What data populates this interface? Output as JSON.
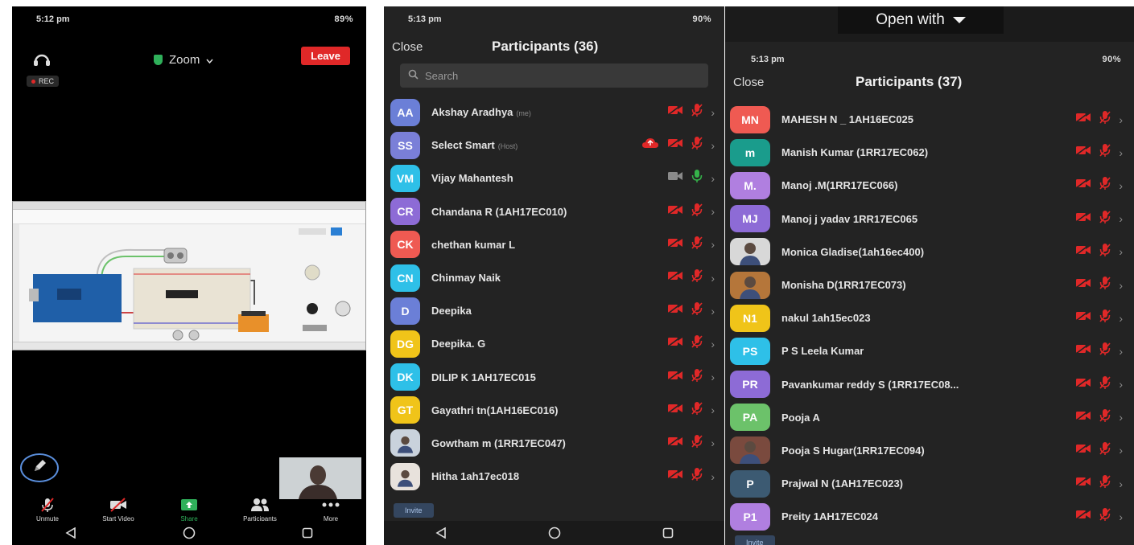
{
  "colors": {
    "accent_red": "#e02828",
    "mic_green": "#35b34a",
    "panel_bg": "#232323",
    "share_green": "#2fb05a"
  },
  "phone1": {
    "status": {
      "time": "5:12 pm",
      "icons": "89%"
    },
    "meeting_title": "Zoom",
    "leave_label": "Leave",
    "rec_label": "REC",
    "controls": [
      {
        "label": "Unmute",
        "icon": "mic-muted-icon"
      },
      {
        "label": "Start Video",
        "icon": "video-off-icon"
      },
      {
        "label": "Share",
        "icon": "share-screen-icon"
      },
      {
        "label": "Participants",
        "icon": "participants-icon"
      },
      {
        "label": "More",
        "icon": "more-dots-icon"
      }
    ]
  },
  "phone2": {
    "status": {
      "time": "5:13 pm",
      "icons": "90%"
    },
    "close_label": "Close",
    "title": "Participants (36)",
    "search_placeholder": "Search",
    "invite_label": "Invite",
    "participants": [
      {
        "initials": "AA",
        "name": "Akshay Aradhya",
        "role": "(me)",
        "color": "#6b7fd7",
        "video": "off",
        "mic": "muted"
      },
      {
        "initials": "SS",
        "name": "Select Smart",
        "role": "(Host)",
        "color": "#7a7fd8",
        "video": "off",
        "mic": "muted",
        "cloud": true
      },
      {
        "initials": "VM",
        "name": "Vijay Mahantesh",
        "role": "",
        "color": "#2ec0e8",
        "video": "on",
        "mic": "on"
      },
      {
        "initials": "CR",
        "name": "Chandana R (1AH17EC010)",
        "role": "",
        "color": "#8d6bd6",
        "video": "off",
        "mic": "muted"
      },
      {
        "initials": "CK",
        "name": "chethan kumar L",
        "role": "",
        "color": "#ef5a52",
        "video": "off",
        "mic": "muted"
      },
      {
        "initials": "CN",
        "name": "Chinmay Naik",
        "role": "",
        "color": "#2ec0e8",
        "video": "off",
        "mic": "muted"
      },
      {
        "initials": "D",
        "name": "Deepika",
        "role": "",
        "color": "#6b7fd7",
        "video": "off",
        "mic": "muted"
      },
      {
        "initials": "DG",
        "name": "Deepika. G",
        "role": "",
        "color": "#f0c419",
        "video": "off",
        "mic": "muted"
      },
      {
        "initials": "DK",
        "name": "DILIP K 1AH17EC015",
        "role": "",
        "color": "#2ec0e8",
        "video": "off",
        "mic": "muted"
      },
      {
        "initials": "GT",
        "name": "Gayathri tn(1AH16EC016)",
        "role": "",
        "color": "#f0c419",
        "video": "off",
        "mic": "muted"
      },
      {
        "initials": "",
        "name": "Gowtham m (1RR17EC047)",
        "role": "",
        "color": "#c9d2dc",
        "video": "off",
        "mic": "muted",
        "photo": true
      },
      {
        "initials": "",
        "name": "Hitha 1ah17ec018",
        "role": "",
        "color": "#e8e2dc",
        "video": "off",
        "mic": "muted",
        "photo": true
      }
    ]
  },
  "phone3": {
    "open_with_label": "Open with",
    "status": {
      "time": "5:13 pm",
      "icons": "90%"
    },
    "close_label": "Close",
    "title": "Participants (37)",
    "invite_label": "Invite",
    "participants": [
      {
        "initials": "MN",
        "name": "MAHESH N _ 1AH16EC025",
        "color": "#ef5a52"
      },
      {
        "initials": "m",
        "name": "Manish Kumar (1RR17EC062)",
        "color": "#1a9c8c"
      },
      {
        "initials": "M.",
        "name": "Manoj .M(1RR17EC066)",
        "color": "#b07fe0"
      },
      {
        "initials": "MJ",
        "name": "Manoj j yadav 1RR17EC065",
        "color": "#8d6bd6"
      },
      {
        "initials": "",
        "name": "Monica Gladise(1ah16ec400)",
        "color": "#d8d8d8",
        "photo": true
      },
      {
        "initials": "",
        "name": "Monisha D(1RR17EC073)",
        "color": "#b5763a",
        "photo": true
      },
      {
        "initials": "N1",
        "name": "nakul 1ah15ec023",
        "color": "#f0c419"
      },
      {
        "initials": "PS",
        "name": "P S Leela Kumar",
        "color": "#2ec0e8"
      },
      {
        "initials": "PR",
        "name": "Pavankumar reddy S (1RR17EC08...",
        "color": "#8d6bd6"
      },
      {
        "initials": "PA",
        "name": "Pooja A",
        "color": "#6cc26a"
      },
      {
        "initials": "",
        "name": "Pooja S Hugar(1RR17EC094)",
        "color": "#7a4a3e",
        "photo": true
      },
      {
        "initials": "P",
        "name": "Prajwal N (1AH17EC023)",
        "color": "#3c5a72"
      },
      {
        "initials": "P1",
        "name": "Preity 1AH17EC024",
        "color": "#b07fe0"
      }
    ]
  }
}
